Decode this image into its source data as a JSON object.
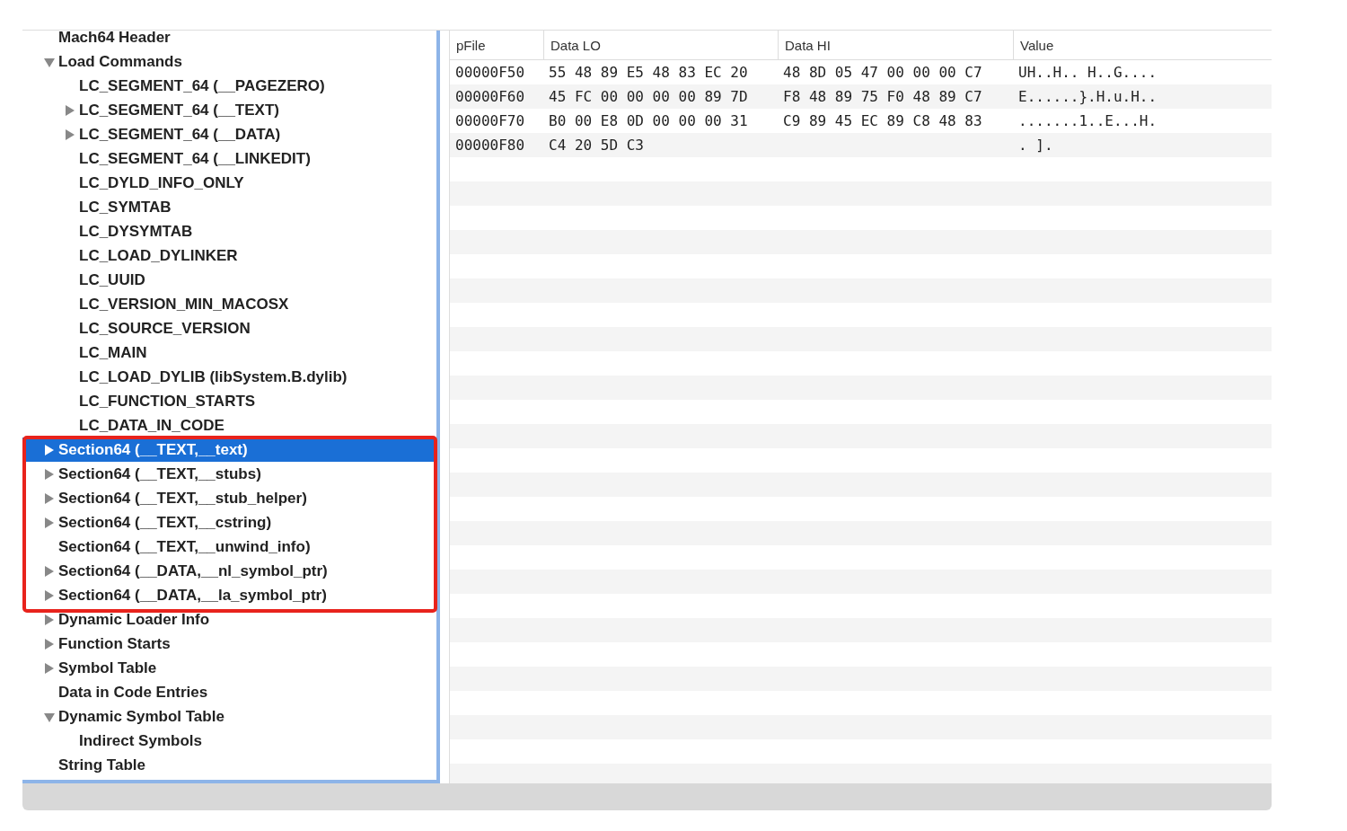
{
  "tree": [
    {
      "label": "Mach64 Header",
      "kind": "leaf"
    },
    {
      "label": "Load Commands",
      "kind": "branch",
      "expanded": true,
      "children": [
        {
          "label": "LC_SEGMENT_64 (__PAGEZERO)",
          "kind": "leaf"
        },
        {
          "label": "LC_SEGMENT_64 (__TEXT)",
          "kind": "branch",
          "expanded": false
        },
        {
          "label": "LC_SEGMENT_64 (__DATA)",
          "kind": "branch",
          "expanded": false
        },
        {
          "label": "LC_SEGMENT_64 (__LINKEDIT)",
          "kind": "leaf"
        },
        {
          "label": "LC_DYLD_INFO_ONLY",
          "kind": "leaf"
        },
        {
          "label": "LC_SYMTAB",
          "kind": "leaf"
        },
        {
          "label": "LC_DYSYMTAB",
          "kind": "leaf"
        },
        {
          "label": "LC_LOAD_DYLINKER",
          "kind": "leaf"
        },
        {
          "label": "LC_UUID",
          "kind": "leaf"
        },
        {
          "label": "LC_VERSION_MIN_MACOSX",
          "kind": "leaf"
        },
        {
          "label": "LC_SOURCE_VERSION",
          "kind": "leaf"
        },
        {
          "label": "LC_MAIN",
          "kind": "leaf"
        },
        {
          "label": "LC_LOAD_DYLIB (libSystem.B.dylib)",
          "kind": "leaf"
        },
        {
          "label": "LC_FUNCTION_STARTS",
          "kind": "leaf"
        },
        {
          "label": "LC_DATA_IN_CODE",
          "kind": "leaf"
        }
      ]
    },
    {
      "label": "Section64 (__TEXT,__text)",
      "kind": "branch",
      "expanded": false,
      "selected": true
    },
    {
      "label": "Section64 (__TEXT,__stubs)",
      "kind": "branch",
      "expanded": false
    },
    {
      "label": "Section64 (__TEXT,__stub_helper)",
      "kind": "branch",
      "expanded": false
    },
    {
      "label": "Section64 (__TEXT,__cstring)",
      "kind": "branch",
      "expanded": false
    },
    {
      "label": "Section64 (__TEXT,__unwind_info)",
      "kind": "leaf"
    },
    {
      "label": "Section64 (__DATA,__nl_symbol_ptr)",
      "kind": "branch",
      "expanded": false
    },
    {
      "label": "Section64 (__DATA,__la_symbol_ptr)",
      "kind": "branch",
      "expanded": false
    },
    {
      "label": "Dynamic Loader Info",
      "kind": "branch",
      "expanded": false
    },
    {
      "label": "Function Starts",
      "kind": "branch",
      "expanded": false
    },
    {
      "label": "Symbol Table",
      "kind": "branch",
      "expanded": false
    },
    {
      "label": "Data in Code Entries",
      "kind": "leaf"
    },
    {
      "label": "Dynamic Symbol Table",
      "kind": "branch",
      "expanded": true,
      "children": [
        {
          "label": "Indirect Symbols",
          "kind": "leaf"
        }
      ]
    },
    {
      "label": "String Table",
      "kind": "leaf"
    }
  ],
  "table": {
    "columns": [
      "pFile",
      "Data LO",
      "Data HI",
      "Value"
    ],
    "rows": [
      [
        "00000F50",
        "55 48 89 E5 48 83 EC 20",
        "48 8D 05 47 00 00 00 C7",
        "UH..H.. H..G...."
      ],
      [
        "00000F60",
        "45 FC 00 00 00 00 89 7D",
        "F8 48 89 75 F0 48 89 C7",
        "E......}.H.u.H.."
      ],
      [
        "00000F70",
        "B0 00 E8 0D 00 00 00 31",
        "C9 89 45 EC 89 C8 48 83",
        ".......1..E...H."
      ],
      [
        "00000F80",
        "C4 20 5D C3",
        "",
        ". ]."
      ]
    ]
  }
}
